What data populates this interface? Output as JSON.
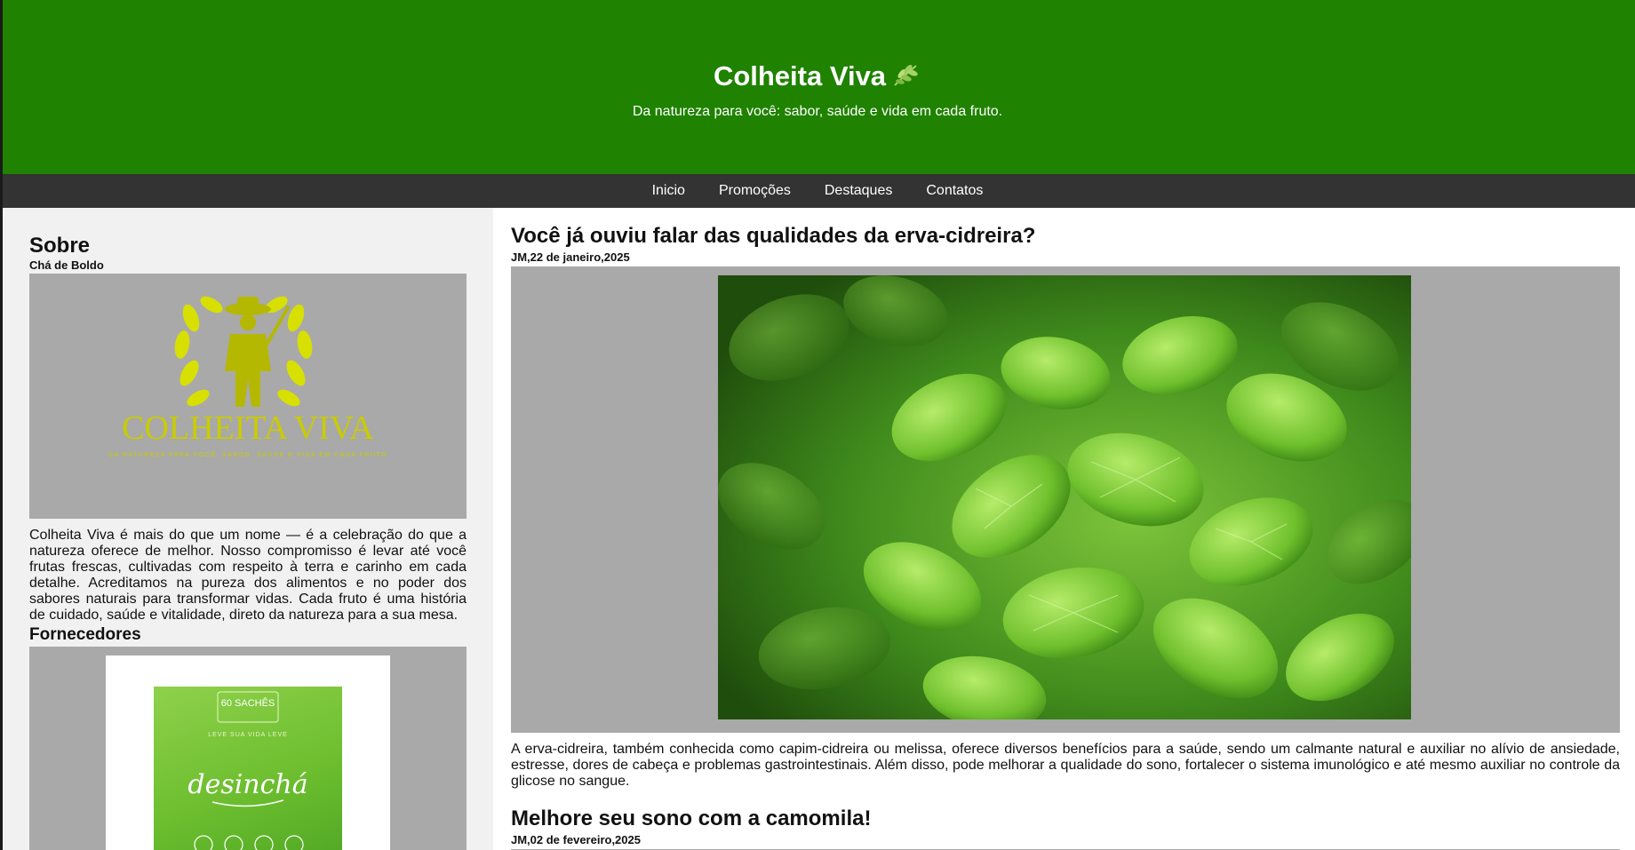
{
  "header": {
    "title": "Colheita Viva",
    "subtitle": "Da natureza para você: sabor, saúde e vida em cada fruto.",
    "title_icon": "leaf-icon",
    "background_color": "#1f8200"
  },
  "nav": {
    "items": [
      {
        "label": "Inicio"
      },
      {
        "label": "Promoções"
      },
      {
        "label": "Destaques"
      },
      {
        "label": "Contatos"
      }
    ],
    "background_color": "#333333"
  },
  "sidebar": {
    "about_heading": "Sobre",
    "about_subheading": "Chá de Boldo",
    "logo": {
      "brand_text": "COLHEITA VIVA",
      "tagline": "DA NATUREZA PARA VOCÊ: SABOR, SAÚDE E VIDA EM CADA FRUTO",
      "icon": "farmer-wreath-logo",
      "color": "#d7e000"
    },
    "about_text": "Colheita Viva é mais do que um nome — é a celebração do que a natureza oferece de melhor. Nosso compromisso é levar até você frutas frescas, cultivadas com respeito à terra e carinho em cada detalhe. Acreditamos na pureza dos alimentos e no poder dos sabores naturais para transformar vidas. Cada fruto é uma história de cuidado, saúde e vitalidade, direto da natureza para a sua mesa.",
    "suppliers_heading": "Fornecedores",
    "supplier_product": {
      "badge_top": "60 SACHÊS",
      "badge_bottom": "LEVE SUA VIDA LEVE",
      "name": "desinchá"
    }
  },
  "posts": [
    {
      "title": "Você já ouviu falar das qualidades da erva-cidreira?",
      "date": "JM,22 de janeiro,2025",
      "image_icon": "lemon-balm-photo",
      "body": "A erva-cidreira, também conhecida como capim-cidreira ou melissa, oferece diversos benefícios para a saúde, sendo um calmante natural e auxiliar no alívio de ansiedade, estresse, dores de cabeça e problemas gastrointestinais. Além disso, pode melhorar a qualidade do sono, fortalecer o sistema imunológico e até mesmo auxiliar no controle da glicose no sangue."
    },
    {
      "title": "Melhore seu sono com a camomila!",
      "date": "JM,02 de fevereiro,2025"
    }
  ]
}
